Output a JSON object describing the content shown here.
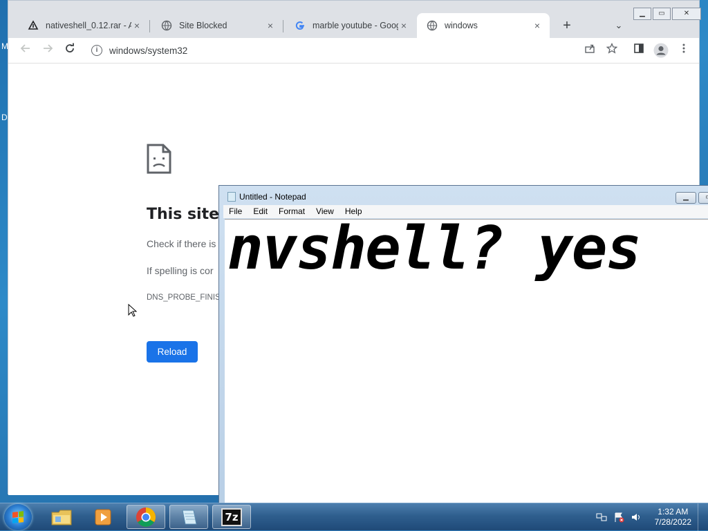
{
  "desktop": {
    "edge_letters": [
      "M",
      "D"
    ]
  },
  "browser": {
    "tabs": [
      {
        "title": "nativeshell_0.12.rar - An",
        "icon": "download-icon",
        "active": false
      },
      {
        "title": "Site Blocked",
        "icon": "globe-icon",
        "active": false
      },
      {
        "title": "marble youtube - Googl",
        "icon": "google-icon",
        "active": false
      },
      {
        "title": "windows",
        "icon": "globe-icon",
        "active": true
      }
    ],
    "tab_close_glyph": "×",
    "new_tab_glyph": "+",
    "tab_search_glyph": "⌄",
    "url": "windows/system32",
    "page": {
      "title": "This site c",
      "line1": "Check if there is",
      "line2": "If spelling is cor",
      "error_code": "DNS_PROBE_FINISH",
      "reload_label": "Reload"
    },
    "colors": {
      "accent": "#1a73e8",
      "tabstrip": "#dee1e6"
    }
  },
  "notepad": {
    "title": "Untitled - Notepad",
    "menu": [
      "File",
      "Edit",
      "Format",
      "View",
      "Help"
    ],
    "text": "nvshell? yes"
  },
  "taskbar": {
    "items": [
      {
        "name": "file-explorer-icon",
        "active": false
      },
      {
        "name": "media-player-icon",
        "active": false
      },
      {
        "name": "chrome-icon",
        "active": true
      },
      {
        "name": "notepad-icon",
        "active": true
      },
      {
        "name": "7zip-icon",
        "active": true,
        "label": "7z"
      }
    ],
    "clock_time": "1:32 AM",
    "clock_date": "7/28/2022"
  }
}
